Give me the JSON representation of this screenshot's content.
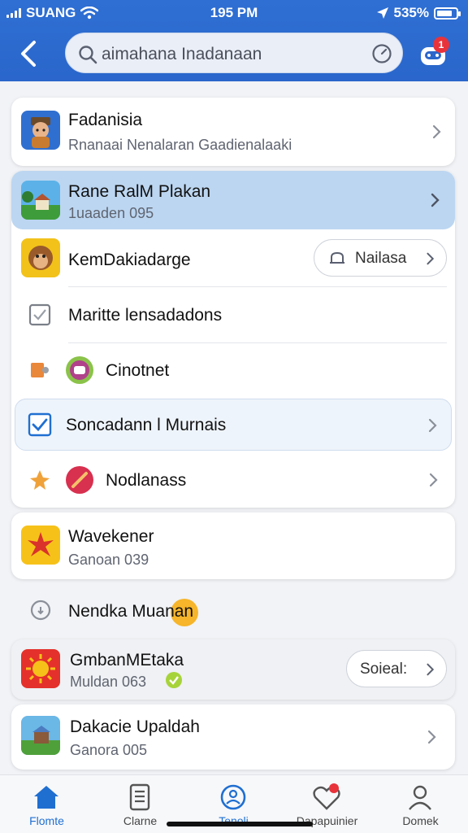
{
  "status_bar": {
    "carrier": "SUANG",
    "time": "195 PM",
    "battery": "535%",
    "battery_level": 0.8
  },
  "search": {
    "value": "aimahana Inadanaan"
  },
  "notifications": {
    "badge": "1"
  },
  "colors": {
    "header": "#2a66cb",
    "accent": "#1f6fd1",
    "highlight": "#bcd6f1",
    "badge": "#e8333b"
  },
  "list": {
    "item1": {
      "title": "Fadanisia",
      "subtitle": "Rnanaai Nenalaran Gaadienalaaki"
    },
    "item2": {
      "title": "Rane RalM Plakan",
      "subtitle": "1uaaden 095"
    },
    "item3": {
      "title": "KemDakiadarge",
      "pill_label": "Nailasa"
    },
    "item4": {
      "title": "Maritte lensadadons",
      "checked": false
    },
    "item5": {
      "title": "Cinotnet"
    },
    "item6": {
      "title": "Soncadann l Murnais",
      "checked": true
    },
    "item7": {
      "title": "Nodlanass"
    },
    "item8": {
      "title": "Wavekener",
      "subtitle": "Ganoan 039"
    },
    "item9": {
      "title": "Nendka Muanan"
    },
    "item10": {
      "title": "GmbanMEtaka",
      "subtitle": "Muldan 063",
      "pill_label": "Soieal:"
    },
    "item11": {
      "title": "Dakacie Upaldah",
      "subtitle": "Ganora 005"
    }
  },
  "tabs": [
    {
      "label": "Flomte",
      "icon": "home-icon",
      "active": true
    },
    {
      "label": "Clarne",
      "icon": "document-icon",
      "active": false
    },
    {
      "label": "Tenoli",
      "icon": "profile-circle-icon",
      "active": true
    },
    {
      "label": "Dapapuinier",
      "icon": "heart-icon",
      "active": false
    },
    {
      "label": "Domek",
      "icon": "user-icon",
      "active": false
    }
  ]
}
